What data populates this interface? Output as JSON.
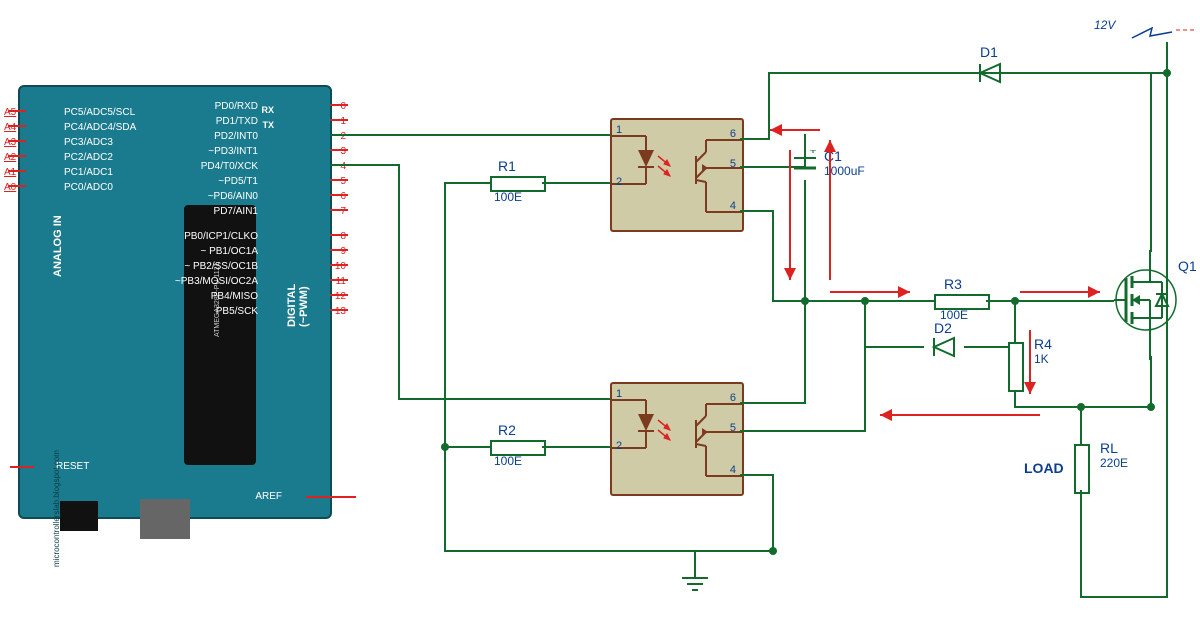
{
  "board": {
    "chip_text": "ATMEGA328P-PU 1121",
    "section_analog": "ANALOG IN",
    "section_digital": "DIGITAL (~PWM)",
    "rx": "RX",
    "tx": "TX",
    "reset": "RESET",
    "aref": "AREF",
    "blog": "microcontrollerslab.blogspot.com",
    "analog_pins": [
      "A5",
      "A4",
      "A3",
      "A2",
      "A1",
      "A0"
    ],
    "analog_labels": [
      "PC5/ADC5/SCL",
      "PC4/ADC4/SDA",
      "PC3/ADC3",
      "PC2/ADC2",
      "PC1/ADC1",
      "PC0/ADC0"
    ],
    "digital_left": [
      "PD0/RXD",
      "PD1/TXD",
      "PD2/INT0",
      "~PD3/INT1",
      "PD4/T0/XCK",
      "~PD5/T1",
      "~PD6/AIN0",
      "PD7/AIN1",
      "PB0/ICP1/CLKO",
      "~ PB1/OC1A",
      "~ PB2/SS/OC1B",
      "~PB3/MOSI/OC2A",
      "PB4/MISO",
      "PB5/SCK"
    ],
    "digital_nums": [
      "0",
      "1",
      "2",
      "3",
      "4",
      "5",
      "6",
      "7",
      "8",
      "9",
      "10",
      "11",
      "12",
      "13"
    ]
  },
  "components": {
    "R1": {
      "name": "R1",
      "value": "100E"
    },
    "R2": {
      "name": "R2",
      "value": "100E"
    },
    "R3": {
      "name": "R3",
      "value": "100E"
    },
    "R4": {
      "name": "R4",
      "value": "1K"
    },
    "RL": {
      "name": "RL",
      "value": "220E"
    },
    "C1": {
      "name": "C1",
      "value": "1000uF"
    },
    "D1": {
      "name": "D1"
    },
    "D2": {
      "name": "D2"
    },
    "Q1": {
      "name": "Q1"
    },
    "LOAD": "LOAD",
    "V12": "12V"
  },
  "opto_pins": {
    "p1": "1",
    "p2": "2",
    "p4": "4",
    "p5": "5",
    "p6": "6"
  }
}
